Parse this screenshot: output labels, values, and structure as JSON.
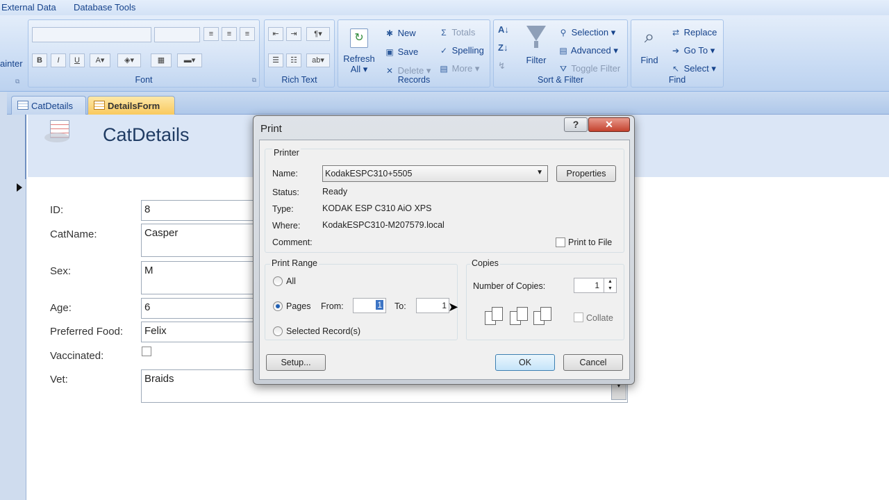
{
  "menu": {
    "external_data": "External Data",
    "database_tools": "Database Tools"
  },
  "ribbon": {
    "painter_partial": "ainter",
    "font": {
      "label": "Font"
    },
    "rich_text": {
      "label": "Rich Text"
    },
    "records": {
      "label": "Records",
      "refresh_line1": "Refresh",
      "refresh_line2": "All",
      "new": "New",
      "save": "Save",
      "delete": "Delete",
      "totals": "Totals",
      "spelling": "Spelling",
      "more": "More"
    },
    "sort_filter": {
      "label": "Sort & Filter",
      "filter": "Filter",
      "selection": "Selection",
      "advanced": "Advanced",
      "toggle_filter": "Toggle Filter"
    },
    "find": {
      "label": "Find",
      "find": "Find",
      "replace": "Replace",
      "goto": "Go To",
      "select": "Select"
    }
  },
  "tabs": [
    {
      "label": "CatDetails",
      "active": false
    },
    {
      "label": "DetailsForm",
      "active": true
    }
  ],
  "form": {
    "title": "CatDetails",
    "fields": [
      {
        "label": "ID:",
        "value": "8"
      },
      {
        "label": "CatName:",
        "value": "Casper"
      },
      {
        "label": "Sex:",
        "value": "M"
      },
      {
        "label": "Age:",
        "value": "6"
      },
      {
        "label": "Preferred Food:",
        "value": "Felix"
      },
      {
        "label": "Vaccinated:",
        "value": ""
      },
      {
        "label": "Vet:",
        "value": "Braids"
      }
    ]
  },
  "dialog": {
    "title": "Print",
    "help_glyph": "?",
    "close_glyph": "✕",
    "printer_group": "Printer",
    "name_label": "Name:",
    "name_value": "KodakESPC310+5505",
    "properties": "Properties",
    "status_label": "Status:",
    "status_value": "Ready",
    "type_label": "Type:",
    "type_value": "KODAK ESP C310 AiO XPS",
    "where_label": "Where:",
    "where_value": "KodakESPC310-M207579.local",
    "comment_label": "Comment:",
    "print_to_file": "Print to File",
    "range_group": "Print Range",
    "all": "All",
    "pages": "Pages",
    "from_label": "From:",
    "from_value": "1",
    "to_label": "To:",
    "to_value": "1",
    "selected_records": "Selected Record(s)",
    "copies_group": "Copies",
    "num_copies_label": "Number of Copies:",
    "num_copies_value": "1",
    "collate": "Collate",
    "setup": "Setup...",
    "ok": "OK",
    "cancel": "Cancel"
  }
}
